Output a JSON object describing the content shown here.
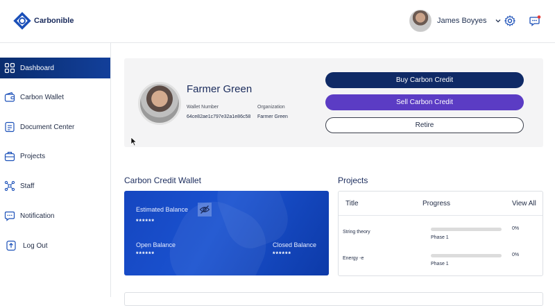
{
  "brand": {
    "name": "Carbonible"
  },
  "user": {
    "name": "James Boyyes"
  },
  "sidebar": {
    "items": [
      {
        "label": "Dashboard",
        "icon": "grid-icon",
        "active": true
      },
      {
        "label": "Carbon Wallet",
        "icon": "wallet-icon"
      },
      {
        "label": "Document Center",
        "icon": "document-icon"
      },
      {
        "label": "Projects",
        "icon": "briefcase-icon"
      },
      {
        "label": "Staff",
        "icon": "staff-icon"
      },
      {
        "label": "Notification",
        "icon": "chat-icon"
      },
      {
        "label": "Log Out",
        "icon": "logout-icon"
      }
    ]
  },
  "profile": {
    "name": "Farmer Green",
    "wallet_label": "Wallet Number",
    "wallet_value": "64ce82ae1c797e32a1e86c58",
    "org_label": "Organization",
    "org_value": "Farmer Green"
  },
  "actions": {
    "buy": "Buy Carbon Credit",
    "sell": "Sell Carbon Credit",
    "retire": "Retire"
  },
  "wallet": {
    "title": "Carbon Credit Wallet",
    "estimated_label": "Estimated Balance",
    "estimated_value": "******",
    "open_label": "Open Balance",
    "open_value": "******",
    "closed_label": "Closed Balance",
    "closed_value": "******"
  },
  "projects": {
    "title": "Projects",
    "col_title": "Title",
    "col_progress": "Progress",
    "view_all": "View All",
    "rows": [
      {
        "name": "String theory",
        "phase": "Phase 1",
        "percent_label": "0%",
        "progress": 0
      },
      {
        "name": "Energy -e",
        "phase": "Phase 1",
        "percent_label": "0%",
        "progress": 0
      }
    ]
  },
  "colors": {
    "primary": "#0f2a66",
    "accent_purple": "#5b3cc4",
    "card_blue": "#1546c0"
  }
}
